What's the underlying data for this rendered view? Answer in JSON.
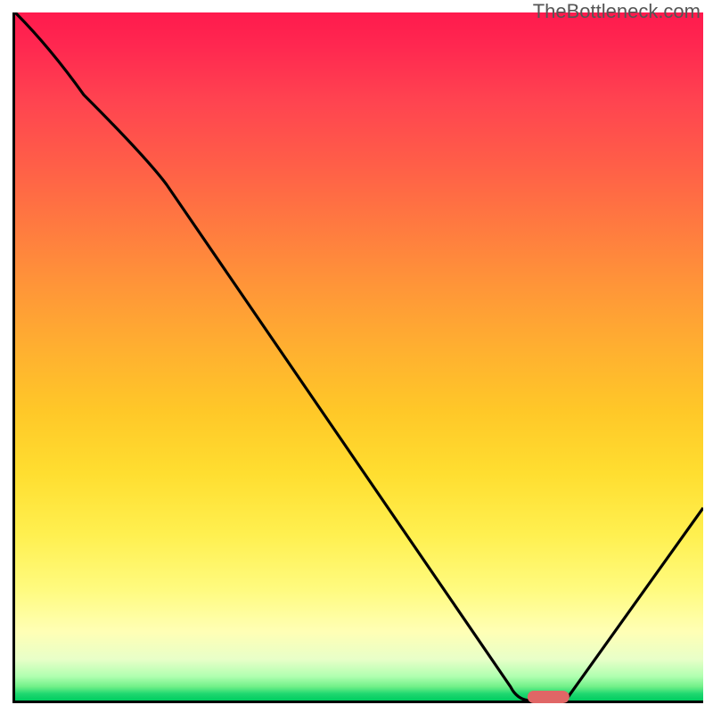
{
  "watermark": "TheBottleneck.com",
  "chart_data": {
    "type": "line",
    "title": "",
    "xlabel": "",
    "ylabel": "",
    "xlim": [
      0,
      100
    ],
    "ylim": [
      0,
      100
    ],
    "x": [
      0,
      10,
      22,
      72,
      75,
      80,
      100
    ],
    "values": [
      100,
      88,
      75,
      2,
      0,
      0,
      28
    ],
    "marker": {
      "x_center": 77.5,
      "y": 0.5,
      "width_pct": 6
    },
    "notes": "Gradient background red→yellow→green (top to bottom); black curve with minimum near x≈77; small red rounded marker at the minimum."
  }
}
